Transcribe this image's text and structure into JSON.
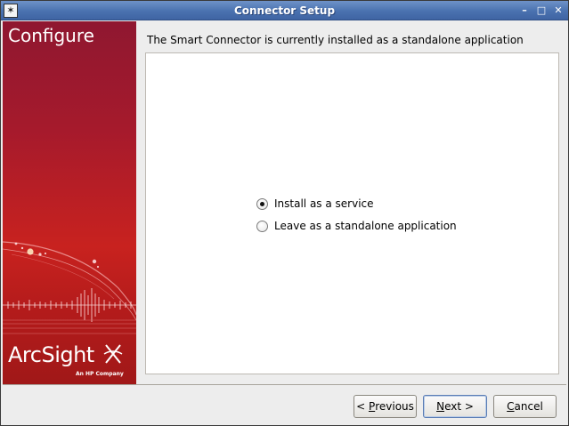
{
  "window": {
    "title": "Connector Setup",
    "app_icon": "✶",
    "controls": {
      "minimize": "–",
      "maximize": "□",
      "close": "✕"
    }
  },
  "side_panel": {
    "heading": "Configure",
    "logo_text": "ArcSight",
    "logo_subtext": "An HP Company",
    "colors": {
      "top": "#8f1730",
      "middle": "#c8221f",
      "bottom": "#a01818"
    }
  },
  "main": {
    "header": "The Smart Connector is currently installed as a standalone application",
    "options": [
      {
        "label": "Install as a service",
        "selected": true
      },
      {
        "label": "Leave as a standalone application",
        "selected": false
      }
    ]
  },
  "buttons": {
    "previous": {
      "prefix": "< ",
      "mnemonic": "P",
      "rest": "revious"
    },
    "next": {
      "mnemonic": "N",
      "rest": "ext >"
    },
    "cancel": {
      "mnemonic": "C",
      "rest": "ancel"
    }
  },
  "icons": {
    "app": "arcsight-app-icon",
    "minimize": "minimize-icon",
    "maximize": "maximize-icon",
    "close": "close-icon",
    "logo": "arcsight-logo-icon"
  }
}
